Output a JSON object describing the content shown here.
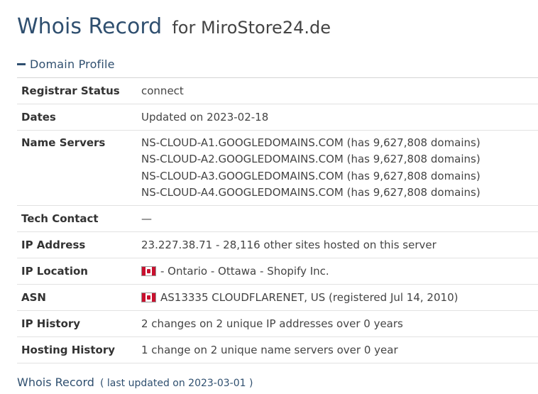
{
  "header": {
    "title": "Whois Record",
    "subtitle": "for MiroStore24.de"
  },
  "section": {
    "label": "Domain Profile"
  },
  "rows": {
    "registrar_status": {
      "label": "Registrar Status",
      "value": "connect"
    },
    "dates": {
      "label": "Dates",
      "value": "Updated on 2023-02-18"
    },
    "name_servers": {
      "label": "Name Servers",
      "values": [
        "NS-CLOUD-A1.GOOGLEDOMAINS.COM (has 9,627,808 domains)",
        "NS-CLOUD-A2.GOOGLEDOMAINS.COM (has 9,627,808 domains)",
        "NS-CLOUD-A3.GOOGLEDOMAINS.COM (has 9,627,808 domains)",
        "NS-CLOUD-A4.GOOGLEDOMAINS.COM (has 9,627,808 domains)"
      ]
    },
    "tech_contact": {
      "label": "Tech Contact",
      "value": "—"
    },
    "ip_address": {
      "label": "IP Address",
      "value": "23.227.38.71 - 28,116 other sites hosted on this server"
    },
    "ip_location": {
      "label": "IP Location",
      "value": "- Ontario - Ottawa - Shopify Inc.",
      "flag": "canada-flag-icon"
    },
    "asn": {
      "label": "ASN",
      "value": "AS13335 CLOUDFLARENET, US (registered Jul 14, 2010)",
      "flag": "canada-flag-icon"
    },
    "ip_history": {
      "label": "IP History",
      "value": "2 changes on 2 unique IP addresses over 0 years"
    },
    "hosting_history": {
      "label": "Hosting History",
      "value": "1 change on 2 unique name servers over 0 year"
    }
  },
  "footer": {
    "title": "Whois Record",
    "note": "( last updated on 2023-03-01 )"
  },
  "colors": {
    "heading": "#2f4f6f",
    "text": "#444444",
    "divider": "#e2e2e2",
    "flag_red": "#c8102e"
  }
}
